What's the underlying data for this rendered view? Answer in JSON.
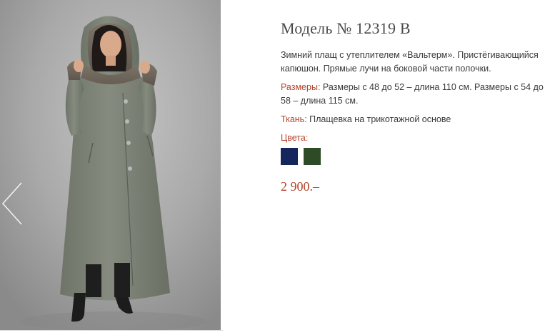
{
  "product": {
    "title": "Модель № 12319 В",
    "description": "Зимний плащ с утеплителем «Вальтерм». Пристёгивающийся капюшон. Прямые лучи на боковой части полочки.",
    "sizes_label": "Размеры:",
    "sizes_value": "Размеры с 48 до 52 – длина 110 см. Размеры с 54 до 58 – длина 115 см.",
    "fabric_label": "Ткань:",
    "fabric_value": "Плащевка на трикотажной основе",
    "colors_label": "Цвета:",
    "colors": [
      {
        "name": "navy",
        "hex": "#14265c"
      },
      {
        "name": "dark-green",
        "hex": "#2e4b28"
      }
    ],
    "price": "2 900.–"
  },
  "gallery": {
    "prev_icon": "chevron-left-icon",
    "photo_alt": "model-in-grey-coat"
  },
  "theme": {
    "accent": "#b5442a",
    "text": "#3a3a3a",
    "title": "#4a4a4a"
  }
}
